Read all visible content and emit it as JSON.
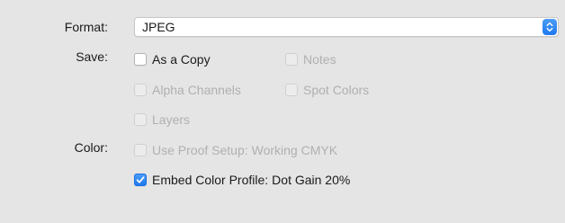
{
  "format": {
    "label": "Format:",
    "value": "JPEG"
  },
  "save": {
    "label": "Save:",
    "as_a_copy": {
      "label": "As a Copy",
      "checked": false,
      "enabled": true
    },
    "notes": {
      "label": "Notes",
      "checked": false,
      "enabled": false
    },
    "alpha_channels": {
      "label": "Alpha Channels",
      "checked": false,
      "enabled": false
    },
    "spot_colors": {
      "label": "Spot Colors",
      "checked": false,
      "enabled": false
    },
    "layers": {
      "label": "Layers",
      "checked": false,
      "enabled": false
    }
  },
  "color": {
    "label": "Color:",
    "use_proof_setup": {
      "label": "Use Proof Setup:",
      "value": "Working CMYK",
      "checked": false,
      "enabled": false
    },
    "embed_color_profile": {
      "label": "Embed Color Profile:",
      "value": "Dot Gain 20%",
      "checked": true,
      "enabled": true
    }
  },
  "colors": {
    "accent": "#1f78ef",
    "background": "#e5e5e5",
    "disabled_text": "#b0b0b0"
  }
}
